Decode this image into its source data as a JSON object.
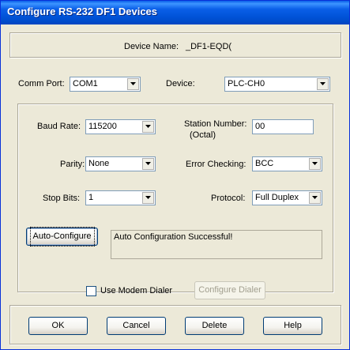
{
  "window": {
    "title": "Configure RS-232 DF1 Devices"
  },
  "device_name": {
    "label": "Device Name:",
    "value": "_DF1-EQD("
  },
  "comm_port": {
    "label": "Comm Port:",
    "value": "COM1"
  },
  "device": {
    "label": "Device:",
    "value": "PLC-CH0"
  },
  "baud_rate": {
    "label": "Baud Rate:",
    "value": "115200"
  },
  "station_number": {
    "label_line1": "Station Number:",
    "label_line2": "(Octal)",
    "value": "00"
  },
  "parity": {
    "label": "Parity:",
    "value": "None"
  },
  "error_checking": {
    "label": "Error Checking:",
    "value": "BCC"
  },
  "stop_bits": {
    "label": "Stop Bits:",
    "value": "1"
  },
  "protocol": {
    "label": "Protocol:",
    "value": "Full Duplex"
  },
  "auto_configure": {
    "label": "Auto-Configure",
    "status": "Auto Configuration Successful!"
  },
  "modem": {
    "checkbox_label": "Use Modem Dialer",
    "checked": false,
    "configure_label": "Configure Dialer"
  },
  "buttons": {
    "ok": "OK",
    "cancel": "Cancel",
    "delete": "Delete",
    "help": "Help"
  },
  "colors": {
    "titlebar": "#0a5fe8",
    "face": "#ece9d8",
    "field_border": "#7f9db9"
  }
}
